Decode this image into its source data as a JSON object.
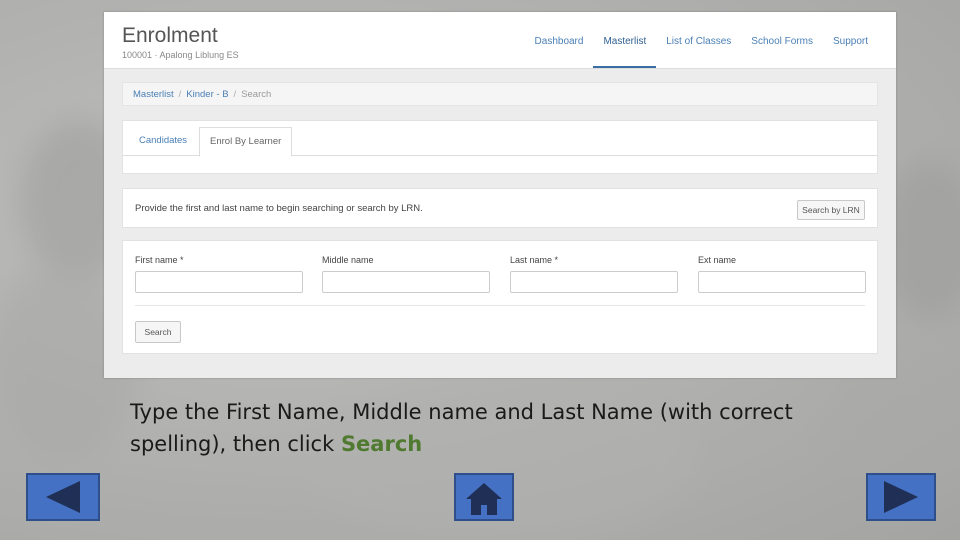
{
  "app": {
    "title": "Enrolment",
    "subtitle": "100001 · Apalong Liblung ES",
    "nav": [
      "Dashboard",
      "Masterlist",
      "List of Classes",
      "School Forms",
      "Support"
    ]
  },
  "breadcrumb": [
    "Masterlist",
    "Kinder - B",
    "Search"
  ],
  "tabs": [
    "Candidates",
    "Enrol By Learner"
  ],
  "info_text": "Provide the first and last name to begin searching or search by LRN.",
  "lrn_button": "Search by LRN",
  "fields": [
    "First name *",
    "Middle name",
    "Last name *",
    "Ext name"
  ],
  "search_button": "Search",
  "caption": {
    "text": "Type the First Name, Middle name and Last Name (with correct spelling), then click ",
    "highlight": "Search"
  },
  "colors": {
    "accent": "#4a7fb5",
    "nav_button": "#4471c4",
    "highlight": "#4f7a2f"
  },
  "icons": [
    "previous-arrow-icon",
    "home-icon",
    "next-arrow-icon"
  ]
}
